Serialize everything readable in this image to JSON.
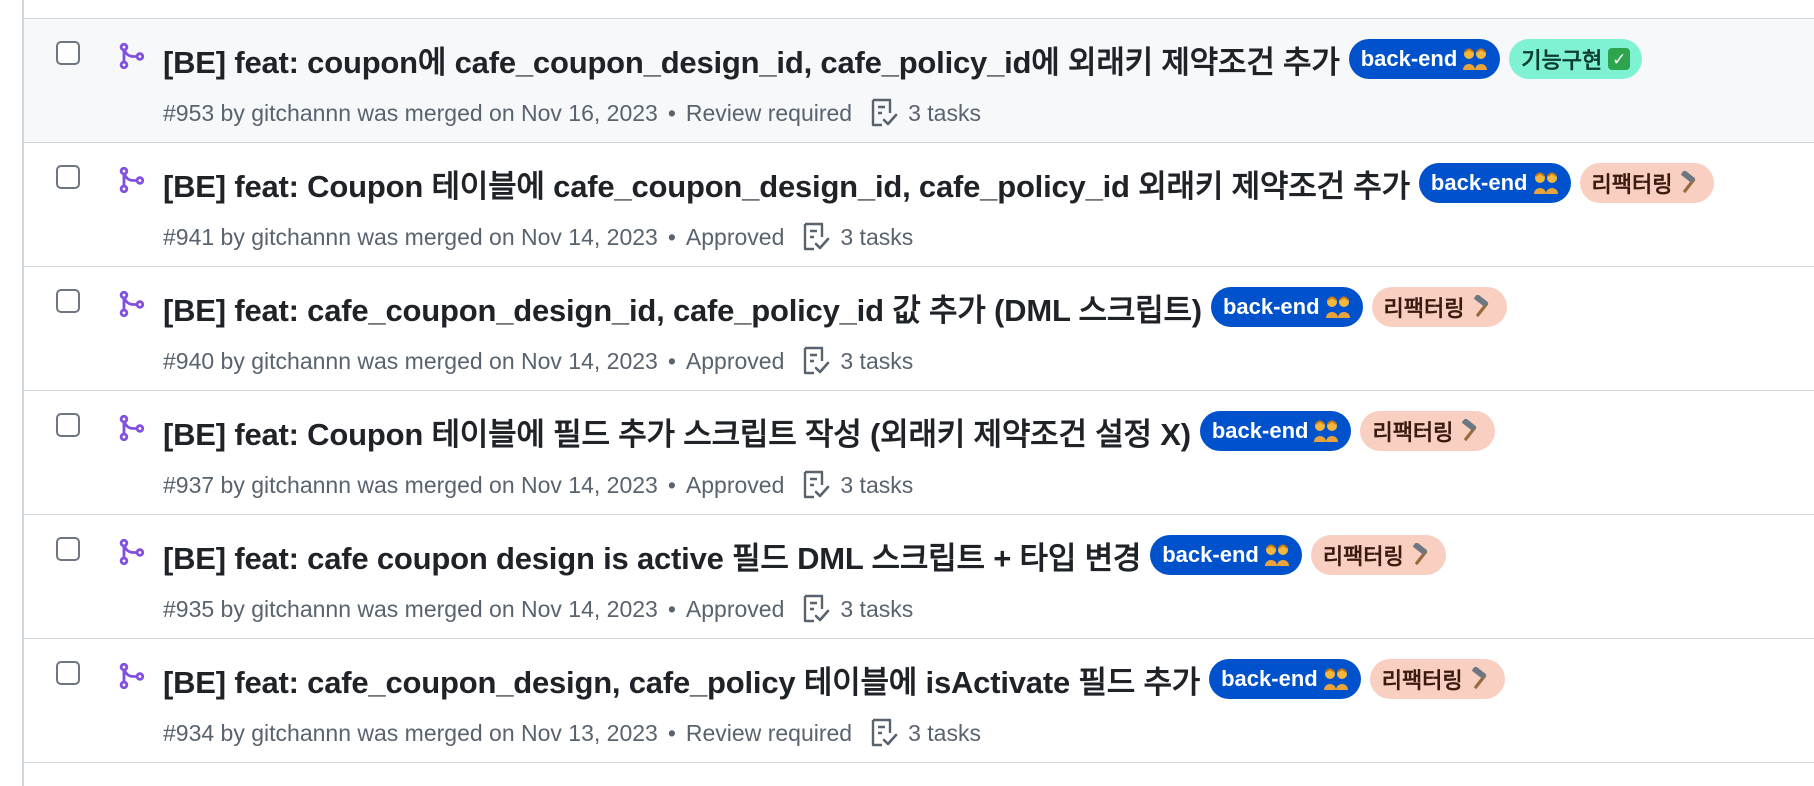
{
  "pull_requests": [
    {
      "title": "[BE] feat: coupon에 cafe_coupon_design_id, cafe_policy_id에 외래키 제약조건 추가",
      "meta": "#953 by gitchannn was merged on Nov 16, 2023",
      "review": "Review required",
      "tasks": "3 tasks",
      "labels": [
        "back-end",
        "기능구현"
      ],
      "label_kinds": [
        "backend",
        "feature"
      ]
    },
    {
      "title": "[BE] feat: Coupon 테이블에 cafe_coupon_design_id, cafe_policy_id 외래키 제약조건 추가",
      "meta": "#941 by gitchannn was merged on Nov 14, 2023",
      "review": "Approved",
      "tasks": "3 tasks",
      "labels": [
        "back-end",
        "리팩터링"
      ],
      "label_kinds": [
        "backend",
        "refactor"
      ]
    },
    {
      "title": "[BE] feat: cafe_coupon_design_id, cafe_policy_id 값 추가 (DML 스크립트)",
      "meta": "#940 by gitchannn was merged on Nov 14, 2023",
      "review": "Approved",
      "tasks": "3 tasks",
      "labels": [
        "back-end",
        "리팩터링"
      ],
      "label_kinds": [
        "backend",
        "refactor"
      ]
    },
    {
      "title": "[BE] feat: Coupon 테이블에 필드 추가 스크립트 작성 (외래키 제약조건 설정 X)",
      "meta": "#937 by gitchannn was merged on Nov 14, 2023",
      "review": "Approved",
      "tasks": "3 tasks",
      "labels": [
        "back-end",
        "리팩터링"
      ],
      "label_kinds": [
        "backend",
        "refactor"
      ]
    },
    {
      "title": "[BE] feat: cafe coupon design is active 필드 DML 스크립트 + 타입 변경",
      "meta": "#935 by gitchannn was merged on Nov 14, 2023",
      "review": "Approved",
      "tasks": "3 tasks",
      "labels": [
        "back-end",
        "리팩터링"
      ],
      "label_kinds": [
        "backend",
        "refactor"
      ]
    },
    {
      "title": "[BE] feat: cafe_coupon_design, cafe_policy 테이블에 isActivate 필드 추가",
      "meta": "#934 by gitchannn was merged on Nov 13, 2023",
      "review": "Review required",
      "tasks": "3 tasks",
      "labels": [
        "back-end",
        "리팩터링"
      ],
      "label_kinds": [
        "backend",
        "refactor"
      ]
    }
  ],
  "icons": {
    "pr": "git-merge-icon",
    "tasks": "checklist-icon",
    "backend_emoji": "people-emoji-icon",
    "feature_emoji": "check-mark-button-icon",
    "refactor_emoji": "hammer-icon"
  },
  "colors": {
    "merged": "#8250df",
    "backend_label": "#0052cc",
    "feature_label": "#7ff2d3",
    "refactor_label": "#f8cfc1",
    "muted_text": "#59636e",
    "border": "#d0d7de"
  },
  "separator": "•"
}
